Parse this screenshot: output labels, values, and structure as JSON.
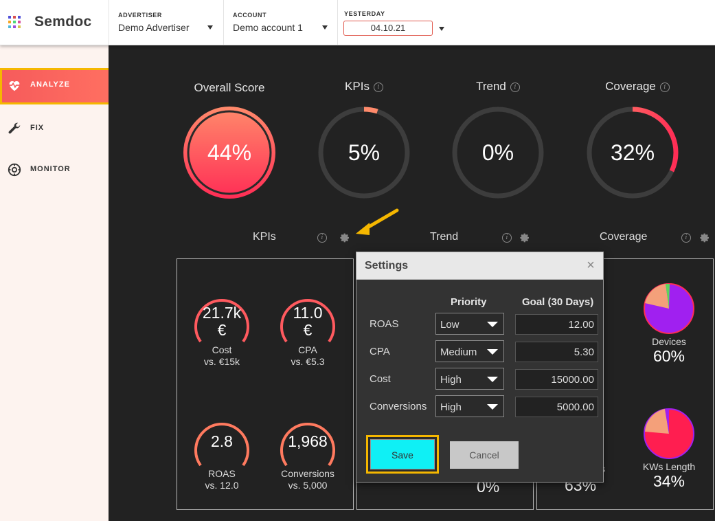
{
  "app": {
    "name": "Semdoc",
    "logo_colors": [
      "#4f4fd9",
      "#d94f4f",
      "#4f4fd9",
      "#f5a623",
      "#4fd97a",
      "#d94f9e",
      "#4fb8d9",
      "#9e4fd9",
      "#d9c34f"
    ]
  },
  "header": {
    "advertiser": {
      "label": "ADVERTISER",
      "value": "Demo Advertiser"
    },
    "account": {
      "label": "ACCOUNT",
      "value": "Demo account 1"
    },
    "date": {
      "label": "YESTERDAY",
      "value": "04.10.21"
    }
  },
  "sidebar": {
    "items": [
      {
        "label": "ANALYZE",
        "icon": "heartbeat-icon",
        "active": true
      },
      {
        "label": "FIX",
        "icon": "wrench-icon",
        "active": false
      },
      {
        "label": "MONITOR",
        "icon": "monitor-dial-icon",
        "active": false
      }
    ]
  },
  "scores": {
    "overall": {
      "title": "Overall Score",
      "value": "44%",
      "percent": 44
    },
    "kpis": {
      "title": "KPIs",
      "value": "5%",
      "percent": 5
    },
    "trend": {
      "title": "Trend",
      "value": "0%",
      "percent": 0
    },
    "coverage": {
      "title": "Coverage",
      "value": "32%",
      "percent": 32
    }
  },
  "sections": {
    "kpis": "KPIs",
    "trend": "Trend",
    "coverage": "Coverage"
  },
  "kpi_panel": {
    "items": [
      {
        "value_line1": "21.7k",
        "value_line2": "€",
        "label": "Cost",
        "sub": "vs. €15k"
      },
      {
        "value_line1": "11.0",
        "value_line2": "€",
        "label": "CPA",
        "sub": "vs. €5.3"
      },
      {
        "value_line1": "2.8",
        "value_line2": "",
        "label": "ROAS",
        "sub": "vs. 12.0"
      },
      {
        "value_line1": "1,968",
        "value_line2": "",
        "label": "Conversions",
        "sub": "vs. 5,000"
      }
    ]
  },
  "coverage_panel": {
    "devices": {
      "label": "Devices",
      "value": "60%"
    },
    "kws_length": {
      "label": "KWs Length",
      "value": "34%"
    },
    "partial_label": "s",
    "partial_value": "63%"
  },
  "trend_panel": {
    "partial_value": "0%"
  },
  "settings_dialog": {
    "title": "Settings",
    "close": "×",
    "col_priority": "Priority",
    "col_goal": "Goal (30 Days)",
    "rows": [
      {
        "label": "ROAS",
        "priority": "Low",
        "goal": "12.00"
      },
      {
        "label": "CPA",
        "priority": "Medium",
        "goal": "5.30"
      },
      {
        "label": "Cost",
        "priority": "High",
        "goal": "15000.00"
      },
      {
        "label": "Conversions",
        "priority": "High",
        "goal": "5000.00"
      }
    ],
    "save": "Save",
    "cancel": "Cancel"
  },
  "colors": {
    "accent": "#ff5a5f",
    "highlight": "#f5b700",
    "save": "#0ff0f5"
  }
}
